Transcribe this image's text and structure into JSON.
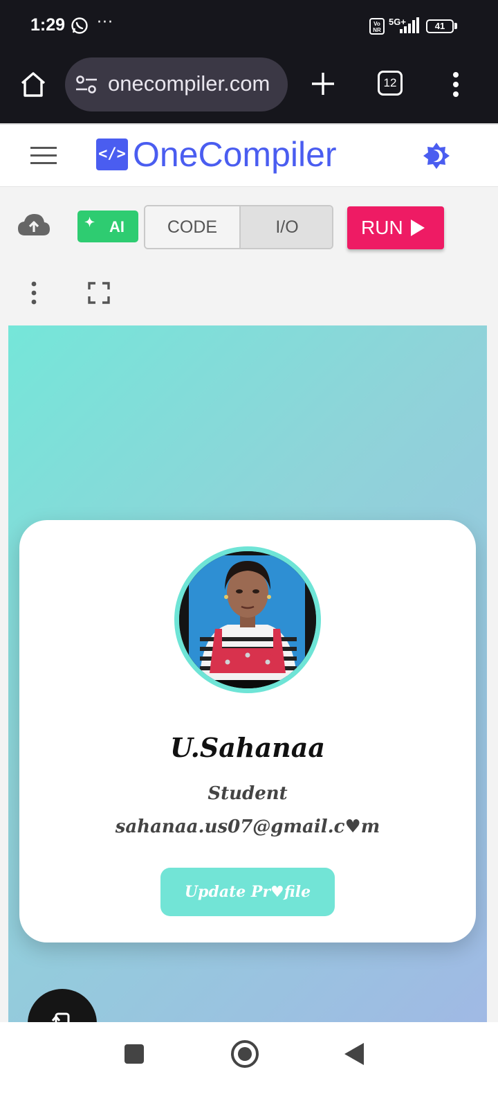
{
  "status_bar": {
    "time": "1:29",
    "overflow": "···",
    "volte": "Vo NR",
    "network": "5G+",
    "battery": "41"
  },
  "browser": {
    "url": "onecompiler.com",
    "tab_count": "12"
  },
  "site": {
    "logo_mark": "</>",
    "logo_text": "OneCompiler"
  },
  "toolbar": {
    "ai_label": "AI",
    "code_tab": "CODE",
    "io_tab": "I/O",
    "run_label": "RUN"
  },
  "profile": {
    "name": "U.Sahanaa",
    "role": "Student",
    "email": "sahanaa.us07@gmail.c♥m",
    "button": "Update Pr♥file"
  },
  "colors": {
    "brand": "#4a5df0",
    "run": "#ee1b64",
    "ai": "#2ecc71",
    "accent_teal": "#72e4d6"
  }
}
